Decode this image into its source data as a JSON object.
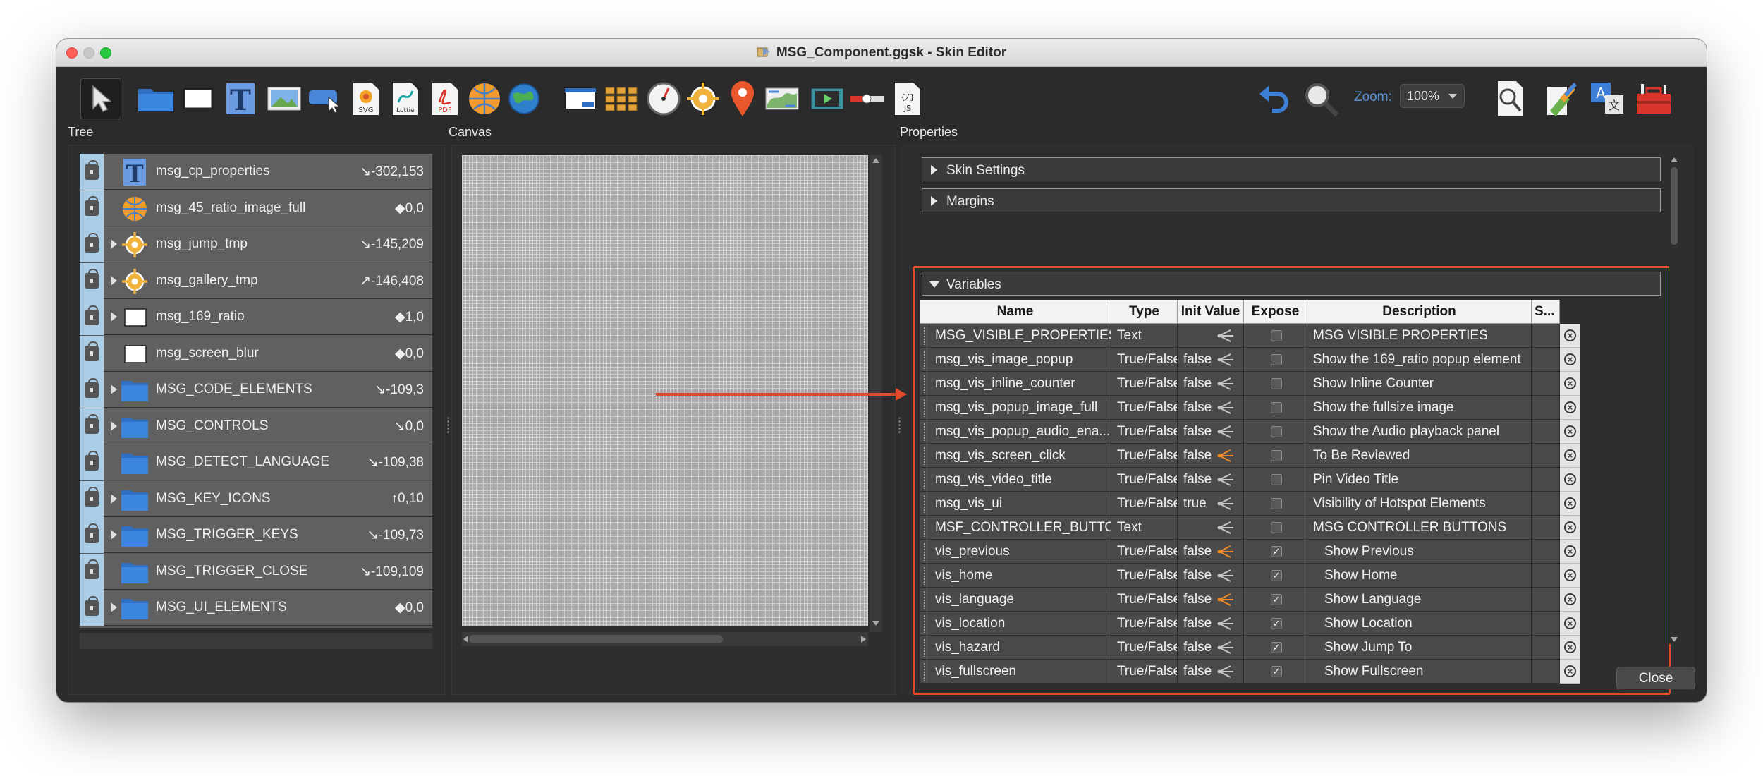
{
  "window": {
    "title": "MSG_Component.ggsk - Skin Editor"
  },
  "toolbar": {
    "tools": [
      {
        "name": "select-tool",
        "icon": "cursor-icon"
      },
      {
        "name": "container-tool",
        "icon": "folder-icon"
      },
      {
        "name": "rectangle-tool",
        "icon": "rectangle-icon"
      },
      {
        "name": "text-tool",
        "icon": "text-icon"
      },
      {
        "name": "image-tool",
        "icon": "image-icon"
      },
      {
        "name": "button-tool",
        "icon": "button-icon"
      },
      {
        "name": "svg-tool",
        "icon": "svg-icon",
        "label": "SVG"
      },
      {
        "name": "lottie-tool",
        "icon": "lottie-icon",
        "label": "Lottie"
      },
      {
        "name": "pdf-tool",
        "icon": "pdf-icon",
        "label": "PDF"
      },
      {
        "name": "map-tool",
        "icon": "globe-icon"
      },
      {
        "name": "cloud-tool",
        "icon": "earth-icon"
      },
      {
        "name": "window-tool",
        "icon": "window-icon"
      },
      {
        "name": "cloner-tool",
        "icon": "grid-icon"
      },
      {
        "name": "compass-tool",
        "icon": "gauge-icon"
      },
      {
        "name": "hotspot-tool",
        "icon": "crosshair-icon"
      },
      {
        "name": "pin-tool",
        "icon": "map-pin-icon"
      },
      {
        "name": "map-image-tool",
        "icon": "map-icon"
      },
      {
        "name": "video-tool",
        "icon": "video-icon"
      },
      {
        "name": "progress-tool",
        "icon": "progress-bar-icon"
      },
      {
        "name": "code-tool",
        "icon": "js-file-icon",
        "label": "JS"
      },
      {
        "name": "undo-tool",
        "icon": "undo-icon"
      },
      {
        "name": "zoom-tool",
        "icon": "magnifier-icon"
      },
      {
        "name": "find-tool",
        "icon": "find-icon"
      },
      {
        "name": "theme-tool",
        "icon": "palette-icon"
      },
      {
        "name": "translate-tool",
        "icon": "translate-icon"
      },
      {
        "name": "tools-tool",
        "icon": "toolbox-icon"
      }
    ],
    "zoom_label": "Zoom:",
    "zoom_value": "100%"
  },
  "panels": {
    "tree": "Tree",
    "canvas": "Canvas",
    "properties": "Properties"
  },
  "tree": {
    "rows": [
      {
        "name": "msg_cp_properties",
        "coord": "↘-302,153",
        "icon": "text-icon",
        "expandable": false
      },
      {
        "name": "msg_45_ratio_image_full",
        "coord": "◆0,0",
        "icon": "globe-icon",
        "expandable": false
      },
      {
        "name": "msg_jump_tmp",
        "coord": "↘-145,209",
        "icon": "crosshair-icon",
        "expandable": true
      },
      {
        "name": "msg_gallery_tmp",
        "coord": "↗-146,408",
        "icon": "crosshair-icon",
        "expandable": true
      },
      {
        "name": "msg_169_ratio",
        "coord": "◆1,0",
        "icon": "rectangle-icon",
        "expandable": true
      },
      {
        "name": "msg_screen_blur",
        "coord": "◆0,0",
        "icon": "rectangle-icon",
        "expandable": false
      },
      {
        "name": "MSG_CODE_ELEMENTS",
        "coord": "↘-109,3",
        "icon": "folder-icon",
        "expandable": true
      },
      {
        "name": "MSG_CONTROLS",
        "coord": "↘0,0",
        "icon": "folder-icon",
        "expandable": true
      },
      {
        "name": "MSG_DETECT_LANGUAGE",
        "coord": "↘-109,38",
        "icon": "folder-icon",
        "expandable": false
      },
      {
        "name": "MSG_KEY_ICONS",
        "coord": "↑0,10",
        "icon": "folder-icon",
        "expandable": true
      },
      {
        "name": "MSG_TRIGGER_KEYS",
        "coord": "↘-109,73",
        "icon": "folder-icon",
        "expandable": true
      },
      {
        "name": "MSG_TRIGGER_CLOSE",
        "coord": "↘-109,109",
        "icon": "folder-icon",
        "expandable": false
      },
      {
        "name": "MSG_UI_ELEMENTS",
        "coord": "◆0,0",
        "icon": "folder-icon",
        "expandable": true
      }
    ]
  },
  "properties": {
    "sections": {
      "skin_settings": "Skin Settings",
      "margins": "Margins",
      "variables": "Variables"
    },
    "columns": {
      "name": "Name",
      "type": "Type",
      "init": "Init Value",
      "expose": "Expose",
      "description": "Description",
      "s": "S..."
    },
    "variables": [
      {
        "name": "MSG_VISIBLE_PROPERTIES",
        "type": "Text",
        "init": "",
        "share_active": false,
        "expose": false,
        "description": "MSG VISIBLE PROPERTIES",
        "indent": false
      },
      {
        "name": "msg_vis_image_popup",
        "type": "True/False",
        "init": "false",
        "share_active": false,
        "expose": false,
        "description": "Show the 169_ratio popup element",
        "indent": false
      },
      {
        "name": "msg_vis_inline_counter",
        "type": "True/False",
        "init": "false",
        "share_active": false,
        "expose": false,
        "description": "Show Inline Counter",
        "indent": false
      },
      {
        "name": "msg_vis_popup_image_full",
        "type": "True/False",
        "init": "false",
        "share_active": false,
        "expose": false,
        "description": "Show the fullsize image",
        "indent": false
      },
      {
        "name": "msg_vis_popup_audio_ena...",
        "type": "True/False",
        "init": "false",
        "share_active": false,
        "expose": false,
        "description": "Show the Audio playback panel",
        "indent": false
      },
      {
        "name": "msg_vis_screen_click",
        "type": "True/False",
        "init": "false",
        "share_active": true,
        "expose": false,
        "description": "To Be Reviewed",
        "indent": false
      },
      {
        "name": "msg_vis_video_title",
        "type": "True/False",
        "init": "false",
        "share_active": false,
        "expose": false,
        "description": "Pin Video Title",
        "indent": false
      },
      {
        "name": "msg_vis_ui",
        "type": "True/False",
        "init": "true",
        "share_active": false,
        "expose": false,
        "description": "Visibility of Hotspot Elements",
        "indent": false
      },
      {
        "name": "MSF_CONTROLLER_BUTTO...",
        "type": "Text",
        "init": "",
        "share_active": false,
        "expose": false,
        "description": "MSG CONTROLLER BUTTONS",
        "indent": false
      },
      {
        "name": "vis_previous",
        "type": "True/False",
        "init": "false",
        "share_active": true,
        "expose": true,
        "description": "Show Previous",
        "indent": true
      },
      {
        "name": "vis_home",
        "type": "True/False",
        "init": "false",
        "share_active": false,
        "expose": true,
        "description": "Show Home",
        "indent": true
      },
      {
        "name": "vis_language",
        "type": "True/False",
        "init": "false",
        "share_active": true,
        "expose": true,
        "description": "Show Language",
        "indent": true
      },
      {
        "name": "vis_location",
        "type": "True/False",
        "init": "false",
        "share_active": false,
        "expose": true,
        "description": "Show Location",
        "indent": true
      },
      {
        "name": "vis_hazard",
        "type": "True/False",
        "init": "false",
        "share_active": false,
        "expose": true,
        "description": "Show Jump To",
        "indent": true
      },
      {
        "name": "vis_fullscreen",
        "type": "True/False",
        "init": "false",
        "share_active": false,
        "expose": true,
        "description": "Show Fullscreen",
        "indent": true
      }
    ]
  },
  "footer": {
    "close_label": "Close"
  },
  "colors": {
    "highlight": "#e24a2c",
    "share_active": "#f08a24",
    "share_idle": "#c8c8c8",
    "zoom_label": "#5a8fd1"
  }
}
